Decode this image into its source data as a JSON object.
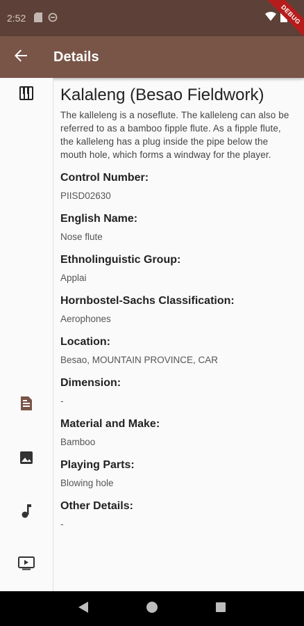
{
  "status_bar": {
    "time": "2:52",
    "debug_label": "DEBUG"
  },
  "app_bar": {
    "title": "Details"
  },
  "instrument": {
    "title": "Kalaleng (Besao Fieldwork)",
    "description": "The kalleleng is a noseflute. The kalleleng can also be referred to as a bamboo fipple flute. As a fipple flute, the kalleleng has a plug inside the pipe below the mouth hole, which forms a windway for the player."
  },
  "fields": [
    {
      "label": "Control Number:",
      "value": "PIISD02630"
    },
    {
      "label": "English Name:",
      "value": "Nose flute"
    },
    {
      "label": "Ethnolinguistic Group:",
      "value": "Applai"
    },
    {
      "label": "Hornbostel-Sachs Classification:",
      "value": "Aerophones"
    },
    {
      "label": "Location:",
      "value": "Besao, MOUNTAIN PROVINCE, CAR"
    },
    {
      "label": "Dimension:",
      "value": "-"
    },
    {
      "label": "Material and Make:",
      "value": "Bamboo"
    },
    {
      "label": "Playing Parts:",
      "value": "Blowing hole"
    },
    {
      "label": "Other Details:",
      "value": "-"
    }
  ],
  "rail": {
    "icons": [
      "piano-icon",
      "document-icon",
      "image-icon",
      "music-note-icon",
      "video-icon"
    ],
    "active_color": "#795548",
    "inactive_color": "#333333"
  },
  "colors": {
    "app_bar": "#795548",
    "status_bar": "#5d4037"
  }
}
